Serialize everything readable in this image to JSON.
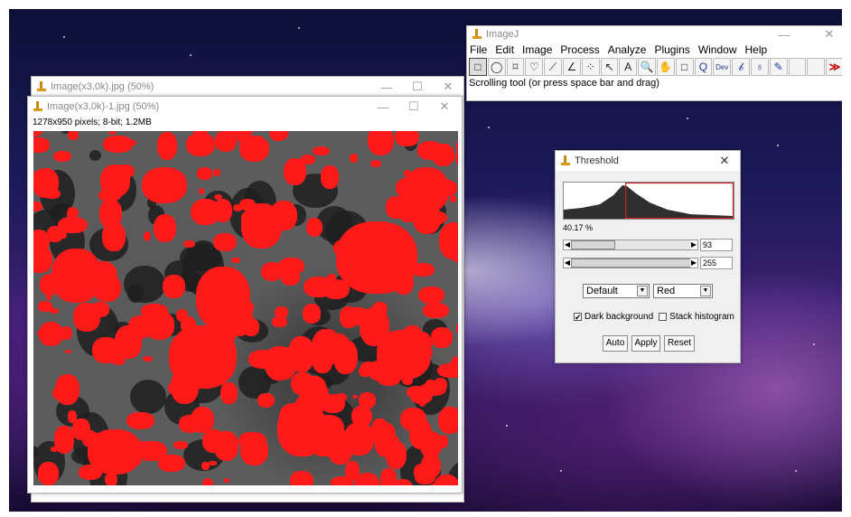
{
  "image_window_back": {
    "title": "Image(x3,0k).jpg (50%)"
  },
  "image_window_front": {
    "title": "Image(x3,0k)-1.jpg (50%)",
    "info": "1278x950 pixels; 8-bit; 1.2MB"
  },
  "imagej": {
    "title": "ImageJ",
    "menus": [
      "File",
      "Edit",
      "Image",
      "Process",
      "Analyze",
      "Plugins",
      "Window",
      "Help"
    ],
    "tools": [
      {
        "name": "rectangle-tool-icon",
        "glyph": "□"
      },
      {
        "name": "oval-tool-icon",
        "glyph": "◯"
      },
      {
        "name": "polygon-tool-icon",
        "glyph": "⌑"
      },
      {
        "name": "freehand-tool-icon",
        "glyph": "♡"
      },
      {
        "name": "line-tool-icon",
        "glyph": "⟋"
      },
      {
        "name": "angle-tool-icon",
        "glyph": "∠"
      },
      {
        "name": "point-tool-icon",
        "glyph": "⁘"
      },
      {
        "name": "wand-tool-icon",
        "glyph": "↖"
      },
      {
        "name": "text-tool-icon",
        "glyph": "A"
      },
      {
        "name": "magnifier-tool-icon",
        "glyph": "🔍"
      },
      {
        "name": "hand-tool-icon",
        "glyph": "✋"
      },
      {
        "name": "color-picker-tool-icon",
        "glyph": "□"
      },
      {
        "name": "zoom-tool-icon",
        "glyph": "Q"
      },
      {
        "name": "dev-tool-icon",
        "glyph": "Dev"
      },
      {
        "name": "brush-tool-icon",
        "glyph": "𝒷"
      },
      {
        "name": "stamp-tool-icon",
        "glyph": "♁"
      },
      {
        "name": "pencil-tool-icon",
        "glyph": "✎"
      },
      {
        "name": "blank-tool-1-icon",
        "glyph": ""
      },
      {
        "name": "blank-tool-2-icon",
        "glyph": ""
      },
      {
        "name": "more-tools-icon",
        "glyph": "≫"
      }
    ],
    "status": "Scrolling tool (or press space bar and drag)"
  },
  "threshold": {
    "title": "Threshold",
    "percent": "40.17 %",
    "min_value": "93",
    "max_value": "255",
    "min_fraction": 0.365,
    "max_fraction": 1.0,
    "method": "Default",
    "display": "Red",
    "dark_background_label": "Dark background",
    "dark_background_checked": true,
    "stack_histogram_label": "Stack histogram",
    "stack_histogram_checked": false,
    "buttons": {
      "auto": "Auto",
      "apply": "Apply",
      "reset": "Reset"
    }
  },
  "colors": {
    "threshold_overlay": "#ff1a1a",
    "histogram_selection": "#cc2222"
  }
}
